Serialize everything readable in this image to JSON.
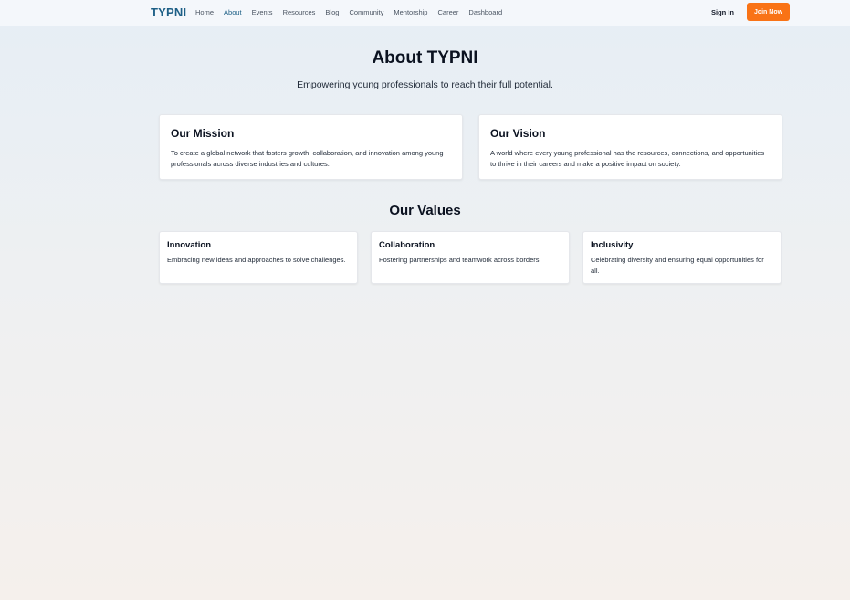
{
  "nav": {
    "brand": "TYPNI",
    "links": [
      "Home",
      "About",
      "Events",
      "Resources",
      "Blog",
      "Community",
      "Mentorship",
      "Career",
      "Dashboard"
    ],
    "active": "About",
    "signin_label": "Sign In",
    "join_label": "Join Now"
  },
  "hero": {
    "title": "About TYPNI",
    "subtitle": "Empowering young professionals to reach their full potential."
  },
  "mission": {
    "title": "Our Mission",
    "text": "To create a global network that fosters growth, collaboration, and innovation among young professionals across diverse industries and cultures."
  },
  "vision": {
    "title": "Our Vision",
    "text": "A world where every young professional has the resources, connections, and opportunities to thrive in their careers and make a positive impact on society."
  },
  "values": {
    "title": "Our Values",
    "items": [
      {
        "title": "Innovation",
        "text": "Embracing new ideas and approaches to solve challenges."
      },
      {
        "title": "Collaboration",
        "text": "Fostering partnerships and teamwork across borders."
      },
      {
        "title": "Inclusivity",
        "text": "Celebrating diversity and ensuring equal opportunities for all."
      }
    ]
  },
  "colors": {
    "brand": "#1d5f86",
    "accent": "#f97316"
  }
}
